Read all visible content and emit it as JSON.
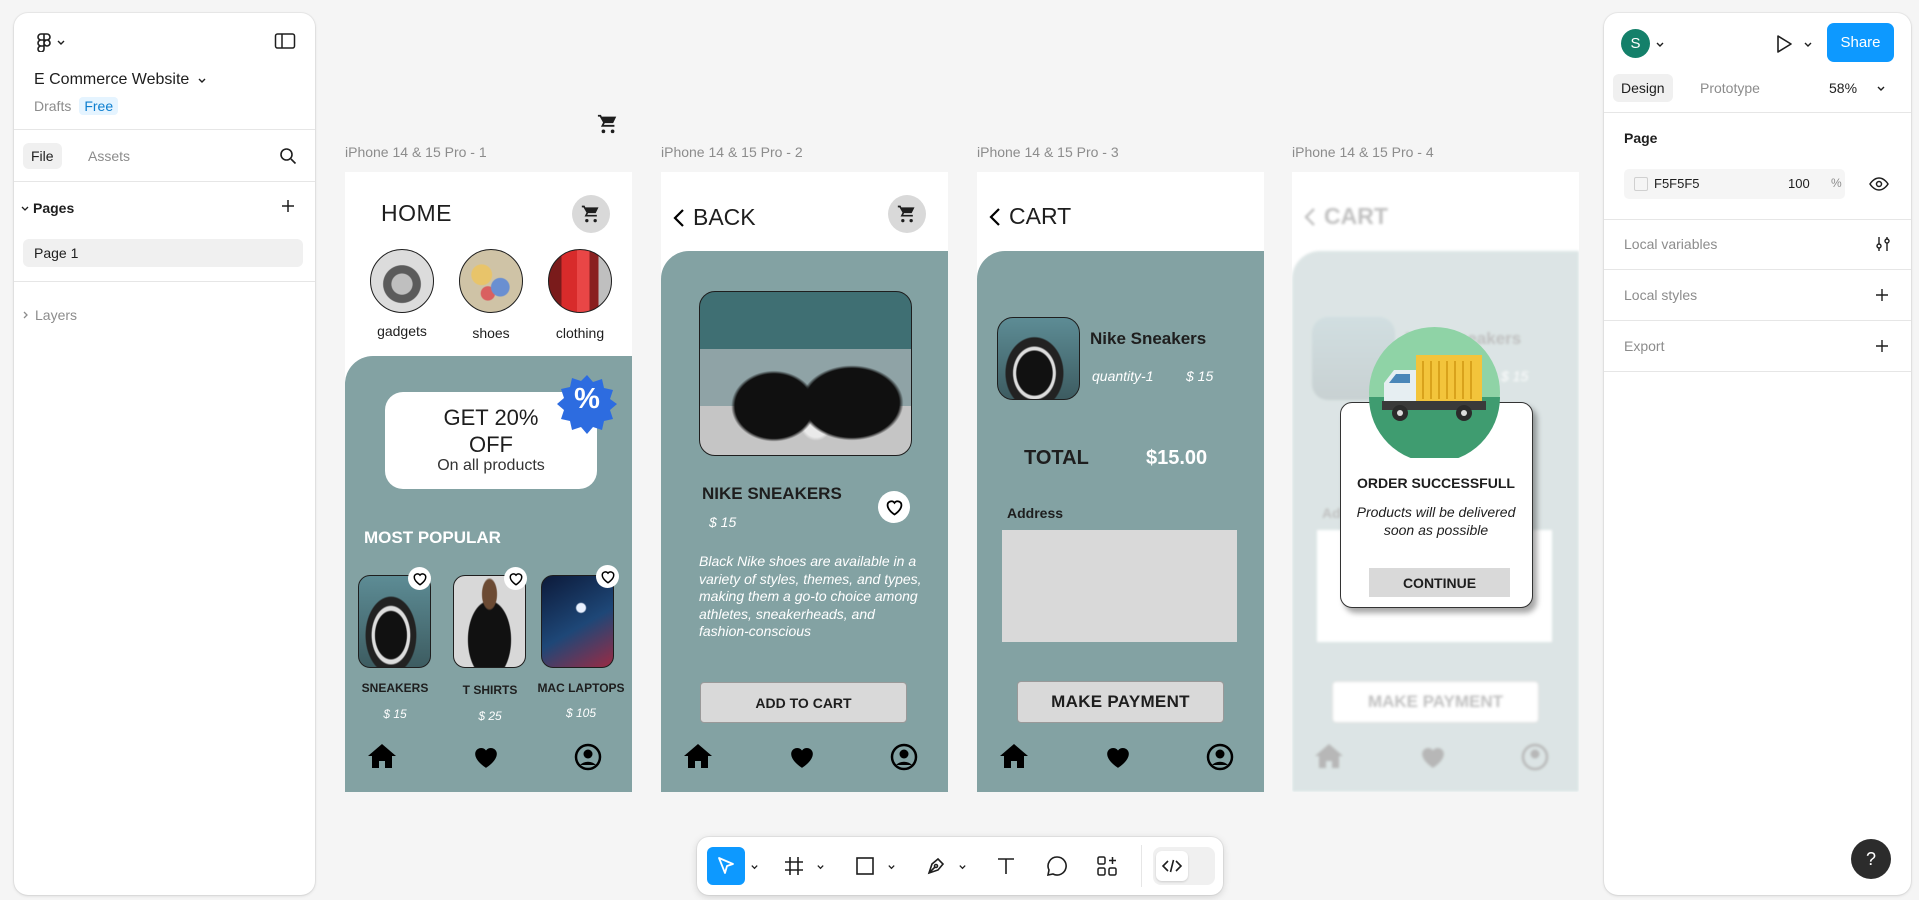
{
  "file": {
    "name": "E Commerce Website",
    "location": "Drafts",
    "plan": "Free"
  },
  "left_panel": {
    "tabs": {
      "file": "File",
      "assets": "Assets"
    },
    "pages_header": "Pages",
    "pages": [
      "Page 1"
    ],
    "layers_header": "Layers"
  },
  "right_panel": {
    "avatar_initial": "S",
    "share_label": "Share",
    "tabs": {
      "design": "Design",
      "prototype": "Prototype"
    },
    "zoom": "58%",
    "page_section": "Page",
    "page_color": "F5F5F5",
    "page_opacity": "100",
    "percent_sign": "%",
    "local_variables": "Local variables",
    "local_styles": "Local styles",
    "export": "Export",
    "help": "?"
  },
  "colors": {
    "accent": "#0d99ff",
    "teal": "#83a2a3",
    "avatar": "#14806a"
  },
  "frames": {
    "labels": [
      "iPhone 14 & 15 Pro - 1",
      "iPhone 14 & 15 Pro - 2",
      "iPhone 14 & 15 Pro - 3",
      "iPhone 14 & 15 Pro - 4"
    ],
    "home": {
      "title": "HOME",
      "categories": [
        "gadgets",
        "shoes",
        "clothing"
      ],
      "promo_line1": "GET 20%",
      "promo_line2": "OFF",
      "promo_sub": "On all products",
      "promo_badge": "%",
      "popular_title": "MOST POPULAR",
      "products": [
        {
          "name": "SNEAKERS",
          "price": "$ 15"
        },
        {
          "name": "T SHIRTS",
          "price": "$ 25"
        },
        {
          "name": "MAC LAPTOPS",
          "price": "$  105"
        }
      ]
    },
    "detail": {
      "back_label": "BACK",
      "name": "NIKE SNEAKERS",
      "price": "$ 15",
      "description": "Black Nike shoes are available in a variety of styles, themes, and types, making them a go-to choice among athletes, sneakerheads, and fashion-conscious",
      "add_to_cart": "ADD TO CART"
    },
    "cart": {
      "title": "CART",
      "item_name": "Nike Sneakers",
      "quantity": "quantity-1",
      "item_price": "$ 15",
      "total_label": "TOTAL",
      "total_value": "$15.00",
      "address_label": "Address",
      "pay_button": "MAKE PAYMENT"
    },
    "success": {
      "bg_title": "CART",
      "bg_item": "Nike Sneakers",
      "bg_price": "$ 15",
      "bg_address": "Ad",
      "bg_pay": "MAKE PAYMENT",
      "title": "ORDER SUCCESSFULL",
      "message": "Products will be delivered soon as possible",
      "continue_label": "CONTINUE"
    }
  }
}
